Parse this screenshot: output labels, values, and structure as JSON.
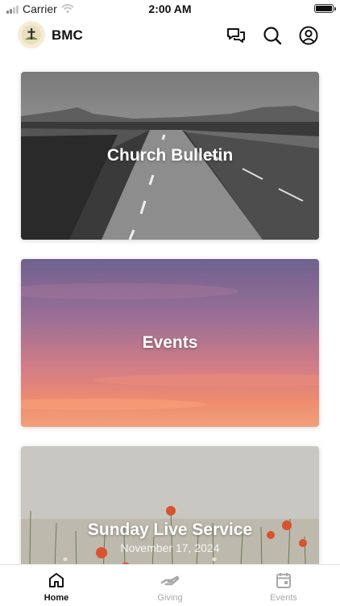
{
  "status_bar": {
    "carrier": "Carrier",
    "time": "2:00 AM"
  },
  "header": {
    "app_title": "BMC"
  },
  "cards": [
    {
      "title": "Church Bulletin",
      "subtitle": ""
    },
    {
      "title": "Events",
      "subtitle": ""
    },
    {
      "title": "Sunday Live Service",
      "subtitle": "November 17, 2024"
    }
  ],
  "tabbar": {
    "home": "Home",
    "giving": "Giving",
    "events": "Events"
  },
  "colors": {
    "active": "#111111",
    "inactive": "#a8a8a8"
  }
}
